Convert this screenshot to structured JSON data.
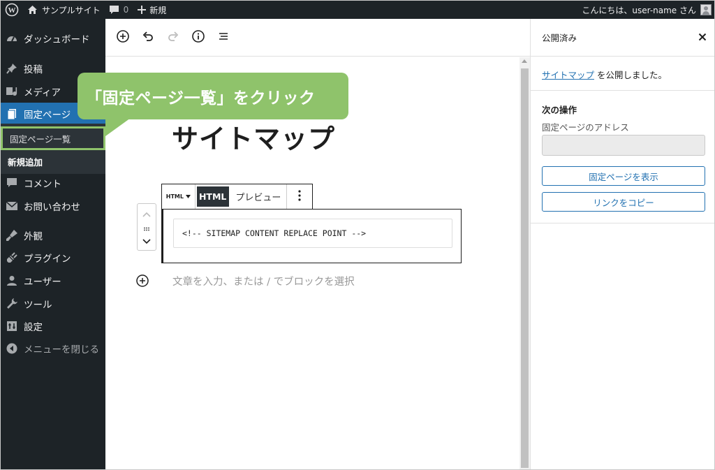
{
  "adminbar": {
    "site_name": "サンプルサイト",
    "comment_count": "0",
    "new_label": "新規",
    "greeting": "こんにちは、user-name さん"
  },
  "sidebar": {
    "items": [
      {
        "label": "ダッシュボード",
        "icon": "dashboard-icon"
      },
      {
        "label": "投稿",
        "icon": "pin-icon"
      },
      {
        "label": "メディア",
        "icon": "media-icon"
      },
      {
        "label": "固定ページ",
        "icon": "pages-icon"
      },
      {
        "label": "コメント",
        "icon": "comment-icon"
      },
      {
        "label": "お問い合わせ",
        "icon": "mail-icon"
      },
      {
        "label": "外観",
        "icon": "appearance-icon"
      },
      {
        "label": "プラグイン",
        "icon": "plugin-icon"
      },
      {
        "label": "ユーザー",
        "icon": "user-icon"
      },
      {
        "label": "ツール",
        "icon": "wrench-icon"
      },
      {
        "label": "設定",
        "icon": "settings-icon"
      },
      {
        "label": "メニューを閉じる",
        "icon": "collapse-icon"
      }
    ],
    "submenu": [
      {
        "label": "固定ページ一覧"
      },
      {
        "label": "新規追加"
      }
    ]
  },
  "callout": {
    "text": "「固定ページ一覧」をクリック",
    "color": "#8fc36b"
  },
  "editor": {
    "title": "サイトマップ",
    "block_type_label": "HTML",
    "html_tab": "HTML",
    "preview_tab": "プレビュー",
    "html_content": "<!-- SITEMAP CONTENT REPLACE POINT -->",
    "placeholder": "文章を入力、または / でブロックを選択"
  },
  "panel": {
    "header": "公開済み",
    "published_link": "サイトマップ",
    "published_suffix": " を公開しました。",
    "next_title": "次の操作",
    "address_label": "固定ページのアドレス",
    "view_button": "固定ページを表示",
    "copy_button": "リンクをコピー"
  },
  "colors": {
    "adminbar": "#1d2327",
    "accent": "#2271b1",
    "highlight": "#8fc36b"
  }
}
